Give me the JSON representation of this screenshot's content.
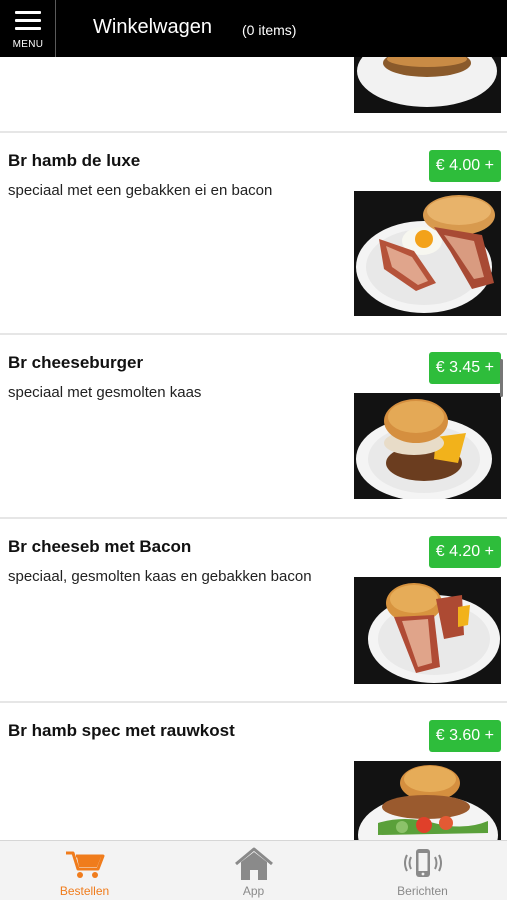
{
  "header": {
    "menu_label": "MENU",
    "title": "Winkelwagen",
    "cart_count": "(0 items)"
  },
  "items": [
    {
      "name": "Br hamb de luxe",
      "description": "speciaal met een gebakken ei en bacon",
      "price": "€ 4.00 +"
    },
    {
      "name": "Br cheeseburger",
      "description": "speciaal met gesmolten kaas",
      "price": "€ 3.45 +"
    },
    {
      "name": "Br cheeseb met Bacon",
      "description": "speciaal, gesmolten kaas en gebakken bacon",
      "price": "€ 4.20 +"
    },
    {
      "name": "Br hamb spec met rauwkost",
      "description": "",
      "price": "€ 3.60 +"
    }
  ],
  "tabs": [
    {
      "label": "Bestellen",
      "icon": "cart-icon",
      "active": true
    },
    {
      "label": "App",
      "icon": "home-icon",
      "active": false
    },
    {
      "label": "Berichten",
      "icon": "phone-vibrate-icon",
      "active": false
    }
  ],
  "colors": {
    "header_bg": "#000000",
    "price_button": "#2ebd3b",
    "active_tab": "#f07c1c",
    "inactive_tab": "#8a8a8a"
  }
}
